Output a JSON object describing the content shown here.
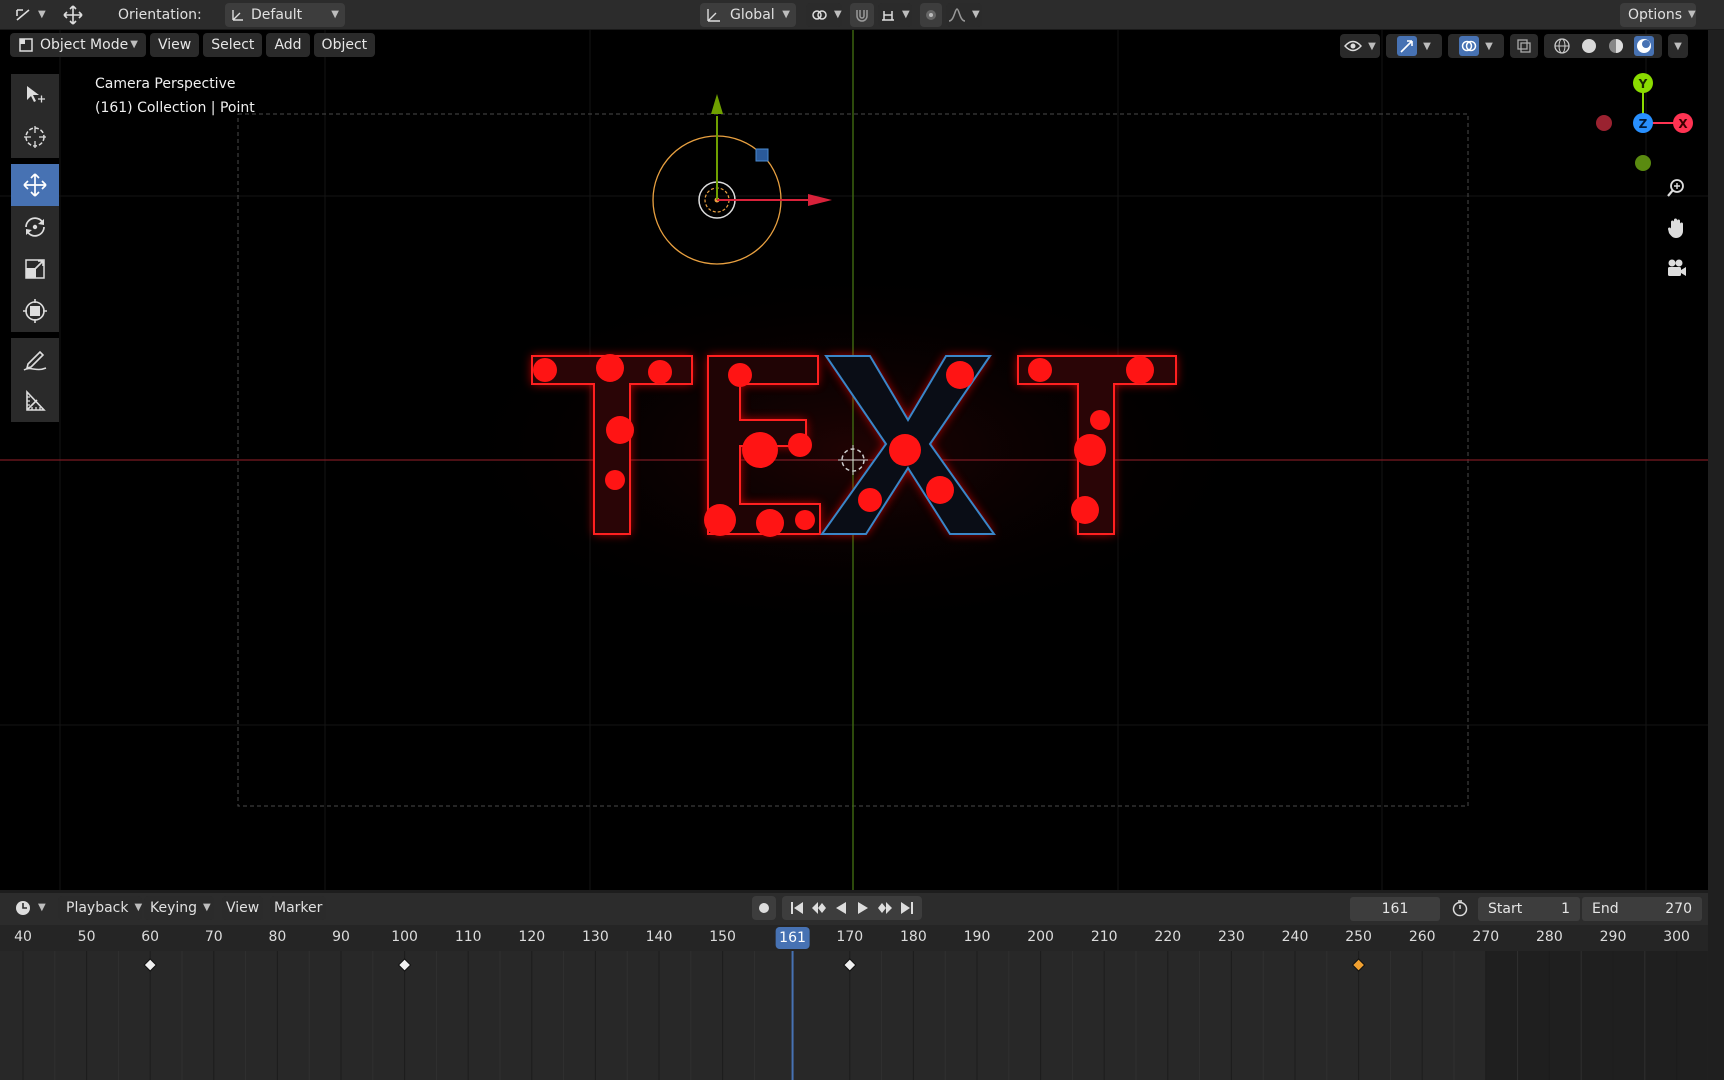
{
  "header": {
    "orientation_label": "Orientation:",
    "orientation_value": "Default",
    "transform_space": "Global",
    "options_label": "Options"
  },
  "viewport": {
    "mode": "Object Mode",
    "menu": [
      "View",
      "Select",
      "Add",
      "Object"
    ],
    "overlay_line1": "Camera Perspective",
    "overlay_line2": "(161) Collection | Point",
    "scene_text": "TEXT",
    "gizmo_axes": [
      "Y",
      "Z",
      "X"
    ]
  },
  "timeline": {
    "menu": [
      "Playback",
      "Keying",
      "View",
      "Marker"
    ],
    "current_frame": "161",
    "start_label": "Start",
    "start_value": "1",
    "end_label": "End",
    "end_value": "270",
    "ruler": [
      "40",
      "50",
      "60",
      "70",
      "80",
      "90",
      "100",
      "110",
      "120",
      "130",
      "140",
      "150",
      "161",
      "170",
      "180",
      "190",
      "200",
      "210",
      "220",
      "230",
      "240",
      "250",
      "260",
      "270",
      "280",
      "290",
      "300"
    ],
    "keyframes": [
      60,
      100,
      170,
      250
    ],
    "selected_keyframe": 250
  },
  "colors": {
    "accent": "#4772b3",
    "text_red": "#ff1a1a",
    "axis_x": "#ff3352",
    "axis_y": "#8bdc00",
    "axis_z": "#2890ff",
    "light_orange": "#e8a040",
    "keyframe_selected": "#f0a030"
  }
}
